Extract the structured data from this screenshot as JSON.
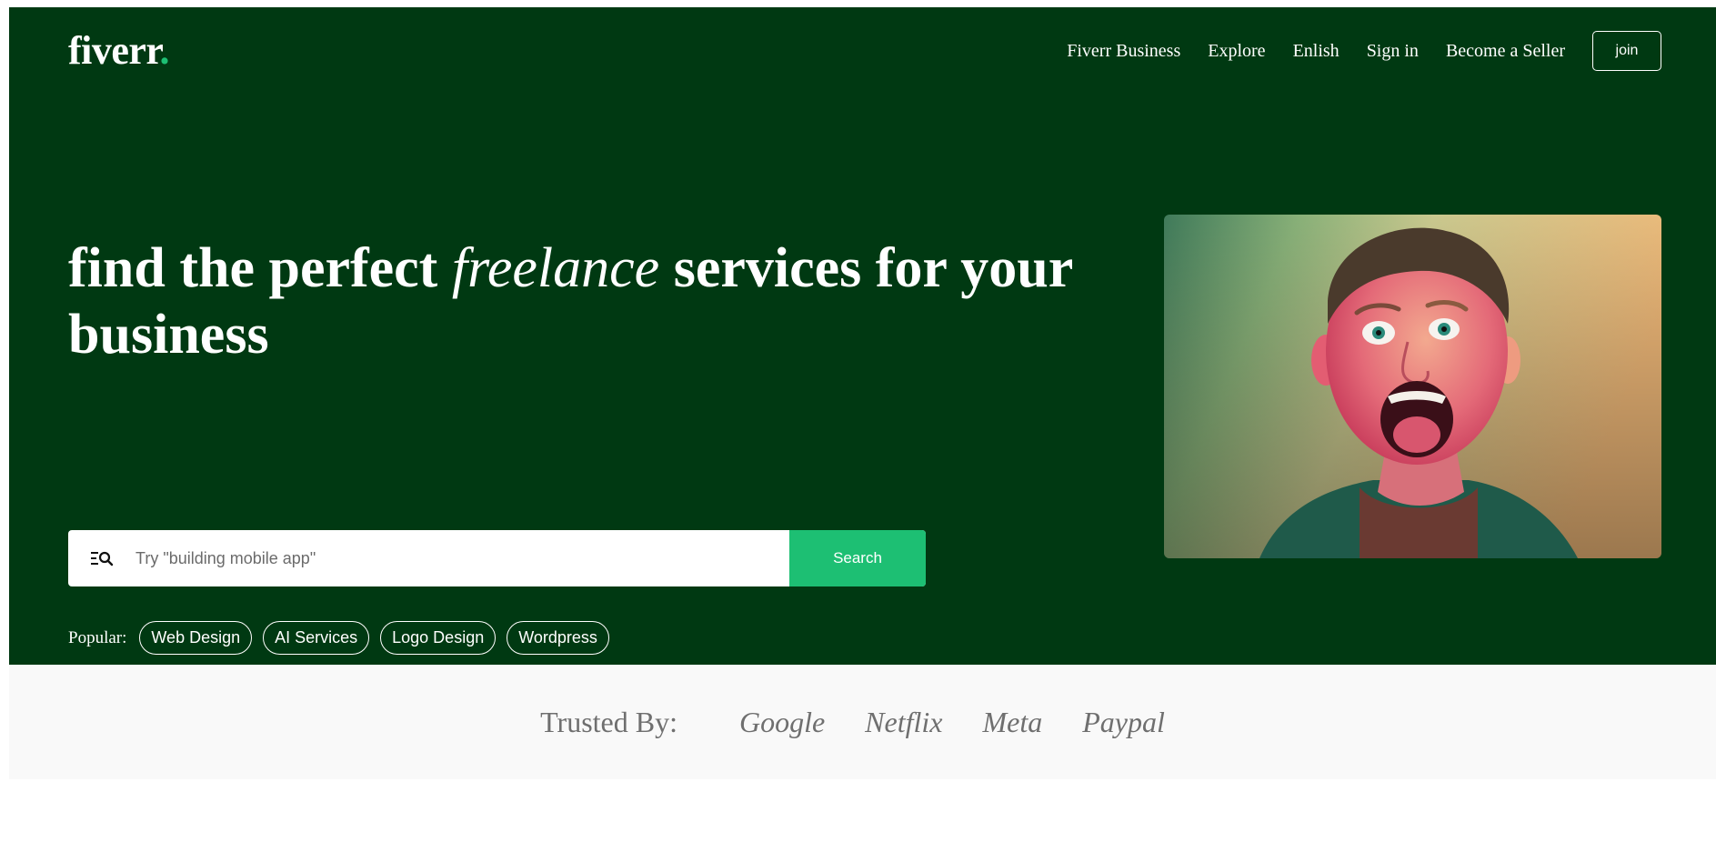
{
  "nav": {
    "logo_text": "fiverr",
    "logo_dot": ".",
    "links": [
      "Fiverr Business",
      "Explore",
      "Enlish",
      "Sign in",
      "Become a Seller"
    ],
    "join_label": "join"
  },
  "hero": {
    "headline_part1": "find the perfect ",
    "headline_italic": "freelance",
    "headline_part2": " services for your business",
    "search": {
      "icon": "search-list-icon",
      "placeholder": "Try \"building mobile app\"",
      "value": "",
      "button_label": "Search"
    },
    "popular_label": "Popular:",
    "popular_tags": [
      "Web Design",
      "AI Services",
      "Logo Design",
      "Wordpress"
    ],
    "image_alt": "Excited man with open mouth on green-to-orange gradient background"
  },
  "trusted": {
    "label": "Trusted By:",
    "brands": [
      "Google",
      "Netflix",
      "Meta",
      "Paypal"
    ]
  },
  "colors": {
    "brand_dark_green": "#003912",
    "accent_green": "#1dbf73",
    "trusted_bg": "#f9f9f9",
    "trusted_text": "#6f6f6f"
  }
}
